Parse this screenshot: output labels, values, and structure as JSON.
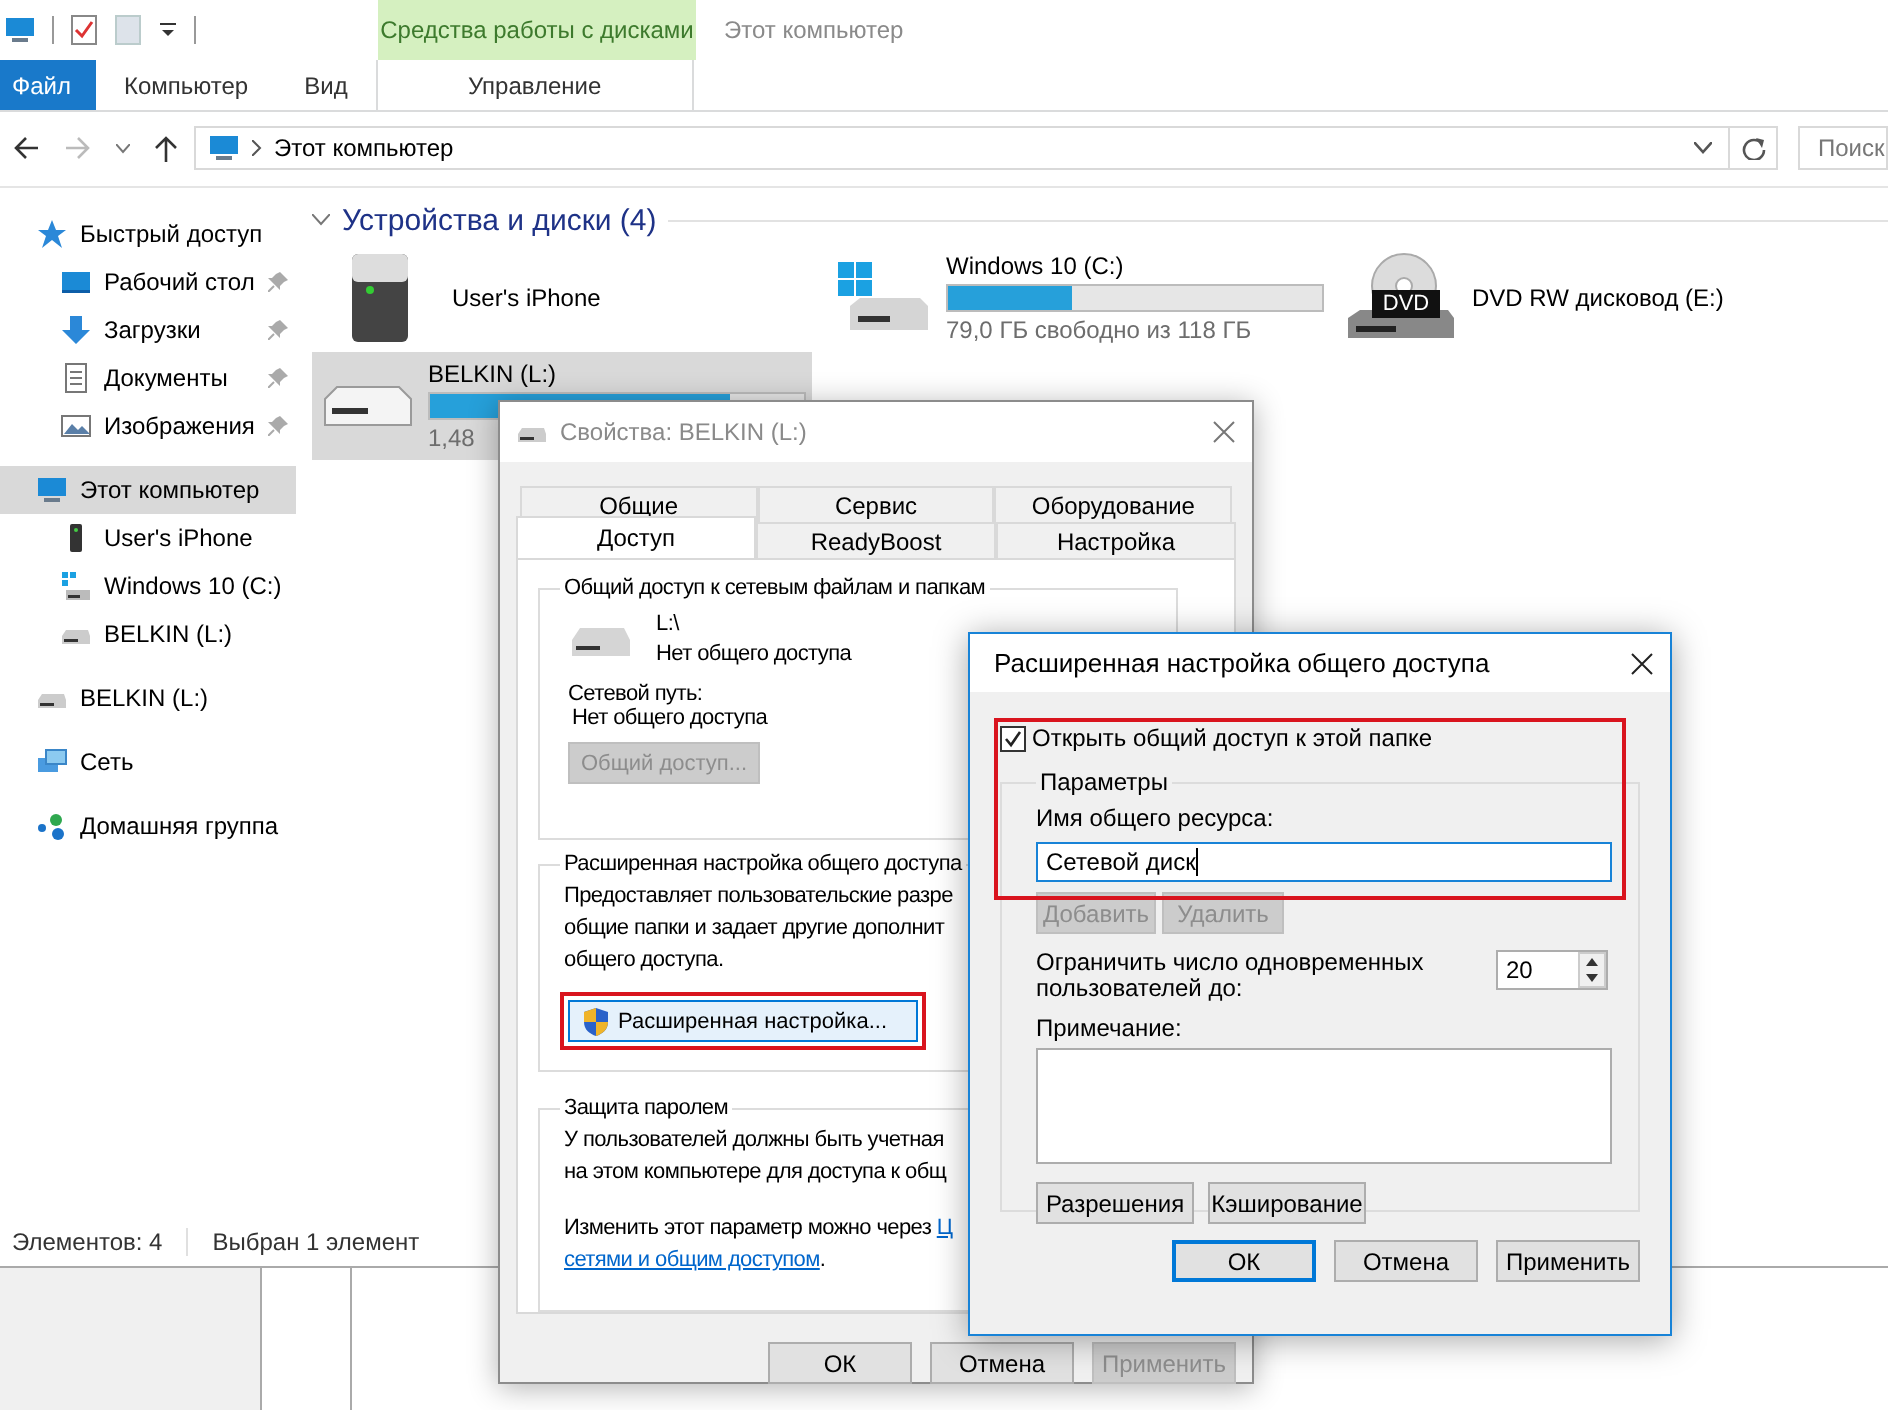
{
  "title_bar": {
    "context_header": "Средства работы с дисками",
    "title": "Этот компьютер"
  },
  "ribbon_tabs": [
    {
      "label": "Файл",
      "kind": "file"
    },
    {
      "label": "Компьютер",
      "kind": "tab"
    },
    {
      "label": "Вид",
      "kind": "tab"
    },
    {
      "label": "Управление",
      "kind": "context"
    }
  ],
  "address_bar": {
    "location": "Этот компьютер",
    "search_placeholder": "Поиск"
  },
  "navigation": [
    {
      "label": "Быстрый доступ",
      "kind": "star",
      "selected": false,
      "children": [
        {
          "label": "Рабочий стол",
          "kind": "desktop",
          "selected": false,
          "pinned": true
        },
        {
          "label": "Загрузки",
          "kind": "downloads",
          "selected": false,
          "pinned": true
        },
        {
          "label": "Документы",
          "kind": "documents",
          "selected": false,
          "pinned": true
        },
        {
          "label": "Изображения",
          "kind": "pictures",
          "selected": false,
          "pinned": true
        }
      ]
    },
    {
      "label": "Этот компьютер",
      "kind": "computer",
      "selected": true,
      "children": [
        {
          "label": "User's iPhone",
          "kind": "phone",
          "selected": false
        },
        {
          "label": "Windows 10 (C:)",
          "kind": "windows-drive",
          "selected": false
        },
        {
          "label": "BELKIN (L:)",
          "kind": "drive",
          "selected": false
        }
      ]
    },
    {
      "label": "BELKIN (L:)",
      "kind": "drive",
      "selected": false
    },
    {
      "label": "Сеть",
      "kind": "network",
      "selected": false
    },
    {
      "label": "Домашняя группа",
      "kind": "homegroup",
      "selected": false
    }
  ],
  "devices": {
    "header": "Устройства и диски (4)",
    "items": [
      {
        "kind": "phone",
        "name": "User's iPhone",
        "selected": false
      },
      {
        "kind": "windows-drive",
        "name": "Windows 10 (C:)",
        "level": 0.33,
        "free": "79,0 ГБ свободно из 118 ГБ",
        "selected": false
      },
      {
        "kind": "dvd",
        "name": "DVD RW дисковод (E:)",
        "icon_label": "DVD",
        "selected": false
      },
      {
        "kind": "drive",
        "name": "BELKIN (L:)",
        "level": 0.8,
        "free": "1,48",
        "selected": true
      }
    ]
  },
  "status_bar": {
    "item_count": "Элементов: 4",
    "selection": "Выбран 1 элемент"
  },
  "properties_dialog": {
    "title": "Свойства: BELKIN (L:)",
    "tab_rows": [
      {
        "tabs": [
          {
            "label": "Общие",
            "selected": false
          },
          {
            "label": "Сервис",
            "selected": false
          },
          {
            "label": "Оборудование",
            "selected": false
          }
        ]
      },
      {
        "tabs": [
          {
            "label": "Доступ",
            "selected": true
          },
          {
            "label": "ReadyBoost",
            "selected": false
          },
          {
            "label": "Настройка",
            "selected": false
          }
        ]
      }
    ],
    "network_sharing": {
      "legend": "Общий доступ к сетевым файлам и папкам",
      "path": "L:\\",
      "status": "Нет общего доступа",
      "network_path_label": "Сетевой путь:",
      "network_path": "Нет общего доступа",
      "share_button": {
        "label": "Общий доступ...",
        "disabled": true
      }
    },
    "advanced_sharing": {
      "legend": "Расширенная настройка общего доступа",
      "description_lines": [
        "Предоставляет пользовательские разре",
        "общие папки и задает другие дополнит",
        "общего доступа."
      ],
      "button": {
        "label": "Расширенная настройка...",
        "highlighted": true
      }
    },
    "password_protection": {
      "legend": "Защита паролем",
      "description_lines": [
        "У пользователей должны быть учетная",
        "на этом компьютере для доступа к общ"
      ],
      "change_note": {
        "text": "Изменить этот параметр можно через",
        "link": "Ц",
        "link_continued": "сетями и общим доступом",
        "end": "."
      }
    },
    "buttons": [
      {
        "label": "ОК",
        "disabled": false
      },
      {
        "label": "Отмена",
        "disabled": false
      },
      {
        "label": "Применить",
        "disabled": true
      }
    ]
  },
  "advanced_dialog": {
    "title": "Расширенная настройка общего доступа",
    "annotation_frame": true,
    "share_checkbox": {
      "label": "Открыть общий доступ к этой папке",
      "checked": true
    },
    "parameters": {
      "legend": "Параметры",
      "share_name_label": "Имя общего ресурса:",
      "share_name_field": {
        "value": "Сетевой диск",
        "focused": true
      },
      "add_button": {
        "label": "Добавить",
        "disabled": true
      },
      "remove_button": {
        "label": "Удалить",
        "disabled": true
      },
      "user_limit_label": "Ограничить число одновременных пользователей до:",
      "user_limit": "20",
      "comment_label": "Примечание:",
      "buttons": [
        {
          "label": "Разрешения"
        },
        {
          "label": "Кэширование"
        }
      ]
    },
    "buttons": [
      {
        "label": "ОК",
        "default": true
      },
      {
        "label": "Отмена",
        "default": false
      },
      {
        "label": "Применить",
        "default": false
      }
    ]
  }
}
